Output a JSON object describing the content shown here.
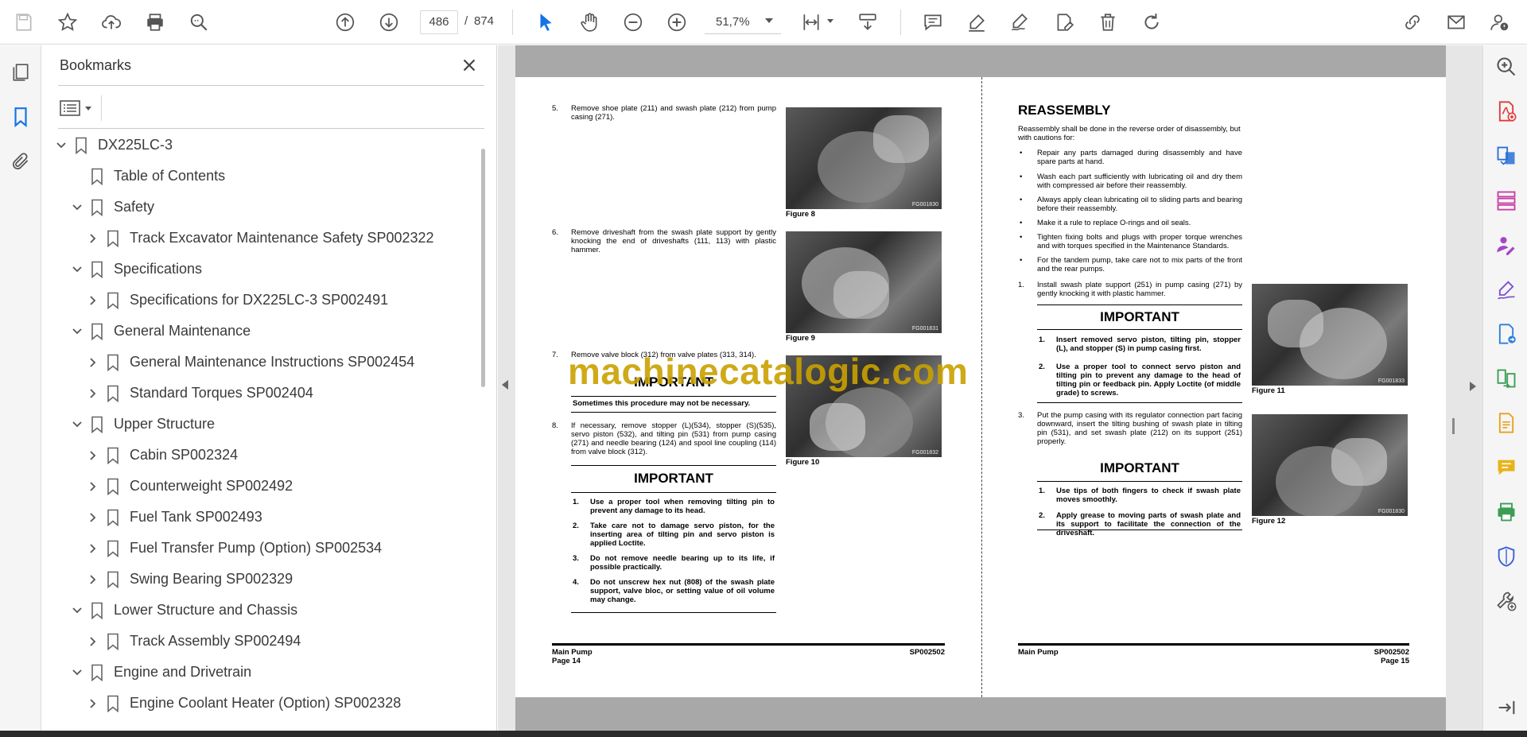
{
  "toolbar": {
    "page_current": "486",
    "page_separator": "/",
    "page_total": "874",
    "zoom": "51,7%"
  },
  "bookmarks": {
    "title": "Bookmarks",
    "items": [
      {
        "label": "DX225LC-3",
        "level": 0,
        "state": "expanded"
      },
      {
        "label": "Table of Contents",
        "level": 1,
        "state": "leaf"
      },
      {
        "label": "Safety",
        "level": 1,
        "state": "expanded"
      },
      {
        "label": "Track Excavator Maintenance Safety SP002322",
        "level": 2,
        "state": "collapsed"
      },
      {
        "label": "Specifications",
        "level": 1,
        "state": "expanded"
      },
      {
        "label": "Specifications for DX225LC-3 SP002491",
        "level": 2,
        "state": "collapsed"
      },
      {
        "label": "General Maintenance",
        "level": 1,
        "state": "expanded"
      },
      {
        "label": "General Maintenance Instructions SP002454",
        "level": 2,
        "state": "collapsed"
      },
      {
        "label": "Standard Torques SP002404",
        "level": 2,
        "state": "collapsed"
      },
      {
        "label": "Upper Structure",
        "level": 1,
        "state": "expanded"
      },
      {
        "label": "Cabin SP002324",
        "level": 2,
        "state": "collapsed"
      },
      {
        "label": "Counterweight SP002492",
        "level": 2,
        "state": "collapsed"
      },
      {
        "label": "Fuel Tank SP002493",
        "level": 2,
        "state": "collapsed"
      },
      {
        "label": "Fuel Transfer Pump (Option) SP002534",
        "level": 2,
        "state": "collapsed"
      },
      {
        "label": "Swing Bearing SP002329",
        "level": 2,
        "state": "collapsed"
      },
      {
        "label": "Lower Structure and Chassis",
        "level": 1,
        "state": "expanded"
      },
      {
        "label": "Track Assembly SP002494",
        "level": 2,
        "state": "collapsed"
      },
      {
        "label": "Engine and Drivetrain",
        "level": 1,
        "state": "expanded"
      },
      {
        "label": "Engine Coolant Heater (Option) SP002328",
        "level": 2,
        "state": "collapsed"
      }
    ]
  },
  "left_page": {
    "steps": [
      {
        "num": "5.",
        "text": "Remove shoe plate (211) and swash plate (212) from pump casing (271)."
      },
      {
        "num": "6.",
        "text": "Remove driveshaft from the swash plate support by gently knocking the end of driveshafts (111, 113) with plastic hammer."
      },
      {
        "num": "7.",
        "text": "Remove valve block (312) from valve plates (313, 314)."
      },
      {
        "num": "8.",
        "text": "If necessary, remove stopper (L)(534), stopper (S)(535), servo piston (532), and tilting pin (531) from pump casing (271) and needle bearing (124) and spool line coupling (114) from valve block (312)."
      }
    ],
    "figures": [
      {
        "caption": "Figure 8",
        "code": "FG001830"
      },
      {
        "caption": "Figure 9",
        "code": "FG001831"
      },
      {
        "caption": "Figure 10",
        "code": "FG001832"
      }
    ],
    "important1": {
      "title": "IMPORTANT",
      "note": "Sometimes this procedure may not be necessary."
    },
    "important2": {
      "title": "IMPORTANT",
      "items": [
        {
          "num": "1.",
          "text": "Use a proper tool when removing tilting pin to prevent any damage to its head."
        },
        {
          "num": "2.",
          "text": "Take care not to damage servo piston, for the inserting area of tilting pin and servo piston is applied Loctite."
        },
        {
          "num": "3.",
          "text": "Do not remove needle bearing up to its life, if possible practically."
        },
        {
          "num": "4.",
          "text": "Do not unscrew hex nut (808) of the swash plate support, valve bloc, or setting value of oil volume may change."
        }
      ]
    },
    "footer": {
      "section": "Main Pump",
      "page": "Page 14",
      "code": "SP002502"
    }
  },
  "right_page": {
    "heading": "REASSEMBLY",
    "intro": "Reassembly shall be done in the reverse order of disassembly, but with cautions for:",
    "bullets": [
      "Repair any parts damaged during disassembly and have spare parts at hand.",
      "Wash each part sufficiently with lubricating oil and dry them with compressed air before their reassembly.",
      "Always apply clean lubricating oil to sliding parts and bearing before their reassembly.",
      "Make it a rule to replace O-rings and oil seals.",
      "Tighten fixing bolts and plugs with proper torque wrenches and with torques specified in the Maintenance Standards.",
      "For the tandem pump, take care not to mix parts of the front and the rear pumps."
    ],
    "steps": [
      {
        "num": "1.",
        "text": "Install swash plate support (251) in pump casing (271) by gently knocking it with plastic hammer."
      },
      {
        "num": "3.",
        "text": "Put the pump casing with its regulator connection part facing downward, insert the tilting bushing of swash plate in tilting pin (531), and set swash plate (212) on its support (251) properly."
      }
    ],
    "important1": {
      "title": "IMPORTANT",
      "items": [
        {
          "num": "1.",
          "text": "Insert removed servo piston, tilting pin, stopper (L), and stopper (S) in pump casing first."
        },
        {
          "num": "2.",
          "text": "Use a proper tool to connect servo piston and tilting pin to prevent any damage to the head of tilting pin or feedback pin. Apply Loctite (of middle grade) to screws."
        }
      ]
    },
    "important2": {
      "title": "IMPORTANT",
      "items": [
        {
          "num": "1.",
          "text": "Use tips of both fingers to check if swash plate moves smoothly."
        },
        {
          "num": "2.",
          "text": "Apply grease to moving parts of swash plate and its support to facilitate the connection of the driveshaft."
        }
      ]
    },
    "figures": [
      {
        "caption": "Figure 11",
        "code": "FG001833"
      },
      {
        "caption": "Figure 12",
        "code": "FG001830"
      }
    ],
    "footer": {
      "section": "Main Pump",
      "page": "Page 15",
      "code": "SP002502"
    }
  },
  "watermark": "machinecatalogic.com",
  "colors": {
    "accent": "#1473e6",
    "pink_tools": "#e0407a",
    "watermark": "#c9a100"
  }
}
